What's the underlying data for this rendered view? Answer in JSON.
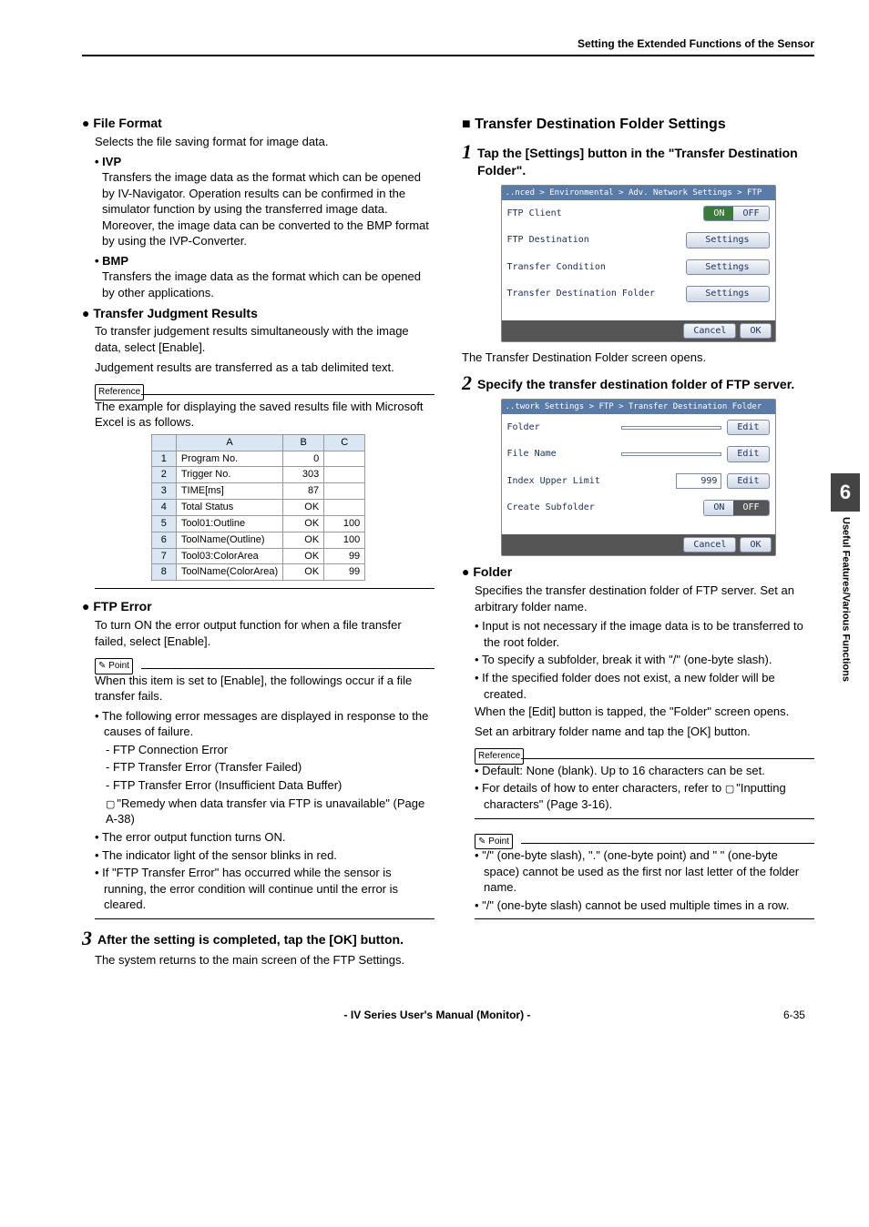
{
  "header": {
    "right": "Setting the Extended Functions of the Sensor"
  },
  "left": {
    "file_format": {
      "title": "File Format",
      "desc": "Selects the file saving format for image data.",
      "ivp_label": "IVP",
      "ivp_body": "Transfers the image data as the format which can be opened by IV-Navigator. Operation results can be confirmed in the simulator function by using the  transferred image data. Moreover, the image data can be converted to the BMP format by using the IVP-Converter.",
      "bmp_label": "BMP",
      "bmp_body": "Transfers the image data as the format which can be opened by other applications."
    },
    "tjr": {
      "title": "Transfer Judgment Results",
      "body1": "To transfer judgement results simultaneously with the image data, select [Enable].",
      "body2": "Judgement results are transferred as a tab delimited text.",
      "ref": "Reference",
      "ref_body": "The example for displaying the saved results file with Microsoft Excel is as follows."
    },
    "excel": {
      "cols": [
        "",
        "A",
        "B",
        "C"
      ],
      "rows": [
        {
          "n": "1",
          "a": "Program No.",
          "b": "0",
          "c": ""
        },
        {
          "n": "2",
          "a": "Trigger No.",
          "b": "303",
          "c": ""
        },
        {
          "n": "3",
          "a": "TIME[ms]",
          "b": "87",
          "c": ""
        },
        {
          "n": "4",
          "a": "Total Status",
          "b": "OK",
          "c": ""
        },
        {
          "n": "5",
          "a": "Tool01:Outline",
          "b": "OK",
          "c": "100"
        },
        {
          "n": "6",
          "a": "ToolName(Outline)",
          "b": "OK",
          "c": "100"
        },
        {
          "n": "7",
          "a": "Tool03:ColorArea",
          "b": "OK",
          "c": "99"
        },
        {
          "n": "8",
          "a": "ToolName(ColorArea)",
          "b": "OK",
          "c": "99"
        }
      ]
    },
    "ftp_error": {
      "title": "FTP Error",
      "body": "To turn ON the error output function for when a file transfer failed, select [Enable].",
      "point": "Point",
      "pbody1": "When this item is set to [Enable], the followings occur if a file transfer fails.",
      "pb1": "The following error messages are displayed in response to the causes of failure.",
      "d1": "- FTP Connection Error",
      "d2": "- FTP Transfer Error (Transfer Failed)",
      "d3": "- FTP Transfer Error (Insufficient Data Buffer)",
      "d4a": "\"Remedy when data transfer via FTP is unavailable\" (Page A-38)",
      "pb2": "The error output function turns ON.",
      "pb3": "The indicator light of the sensor blinks in red.",
      "pb4": "If \"FTP Transfer Error\" has occurred while the sensor is running, the error condition will continue until the error is cleared."
    },
    "step3": {
      "num": "3",
      "text": "After the setting is completed, tap the [OK] button.",
      "body": "The system returns to the main screen of the FTP Settings."
    }
  },
  "right": {
    "tdfs_title": "Transfer Destination Folder Settings",
    "step1": {
      "num": "1",
      "text": "Tap the [Settings] button in the \"Transfer Destination Folder\".",
      "after": "The Transfer Destination Folder screen opens."
    },
    "dev1": {
      "title": "..nced > Environmental > Adv. Network Settings > FTP",
      "r1_label": "FTP Client",
      "r1_on": "ON",
      "r1_off": "OFF",
      "r2_label": "FTP Destination",
      "r2_btn": "Settings",
      "r3_label": "Transfer Condition",
      "r3_btn": "Settings",
      "r4_label": "Transfer Destination Folder",
      "r4_btn": "Settings",
      "cancel": "Cancel",
      "ok": "OK"
    },
    "step2": {
      "num": "2",
      "text": "Specify the transfer destination folder of FTP server."
    },
    "dev2": {
      "title": "..twork Settings > FTP > Transfer Destination Folder",
      "r1_label": "Folder",
      "r1_btn": "Edit",
      "r2_label": "File Name",
      "r2_btn": "Edit",
      "r3_label": "Index Upper Limit",
      "r3_val": "999",
      "r3_btn": "Edit",
      "r4_label": "Create Subfolder",
      "r4_on": "ON",
      "r4_off": "OFF",
      "cancel": "Cancel",
      "ok": "OK"
    },
    "folder": {
      "title": "Folder",
      "b1": "Specifies the transfer destination folder of FTP server. Set an arbitrary folder name.",
      "bl1": "Input is not necessary if the image data is to be transferred to the root folder.",
      "bl2": "To specify a subfolder, break it with \"/\" (one-byte slash).",
      "bl3": "If the specified folder does not exist, a new folder will be created.",
      "b2": "When the [Edit] button is tapped, the \"Folder\" screen opens.",
      "b3": "Set an arbitrary folder name and tap the [OK] button.",
      "ref": "Reference",
      "rbl1": "Default: None (blank). Up to 16 characters can be set.",
      "rbl2": "For details of how to enter characters, refer to",
      "rbl2b": "\"Inputting characters\" (Page 3-16).",
      "point": "Point",
      "pbl1": "\"/\" (one-byte slash), \".\" (one-byte point) and \" \" (one-byte space) cannot be used as the first nor last letter of the folder name.",
      "pbl2": "\"/\" (one-byte slash) cannot be used multiple times in a row."
    }
  },
  "side": {
    "num": "6",
    "txt": "Useful Features/Various Functions"
  },
  "footer": {
    "center": "- IV Series User's Manual (Monitor) -",
    "page": "6-35"
  }
}
